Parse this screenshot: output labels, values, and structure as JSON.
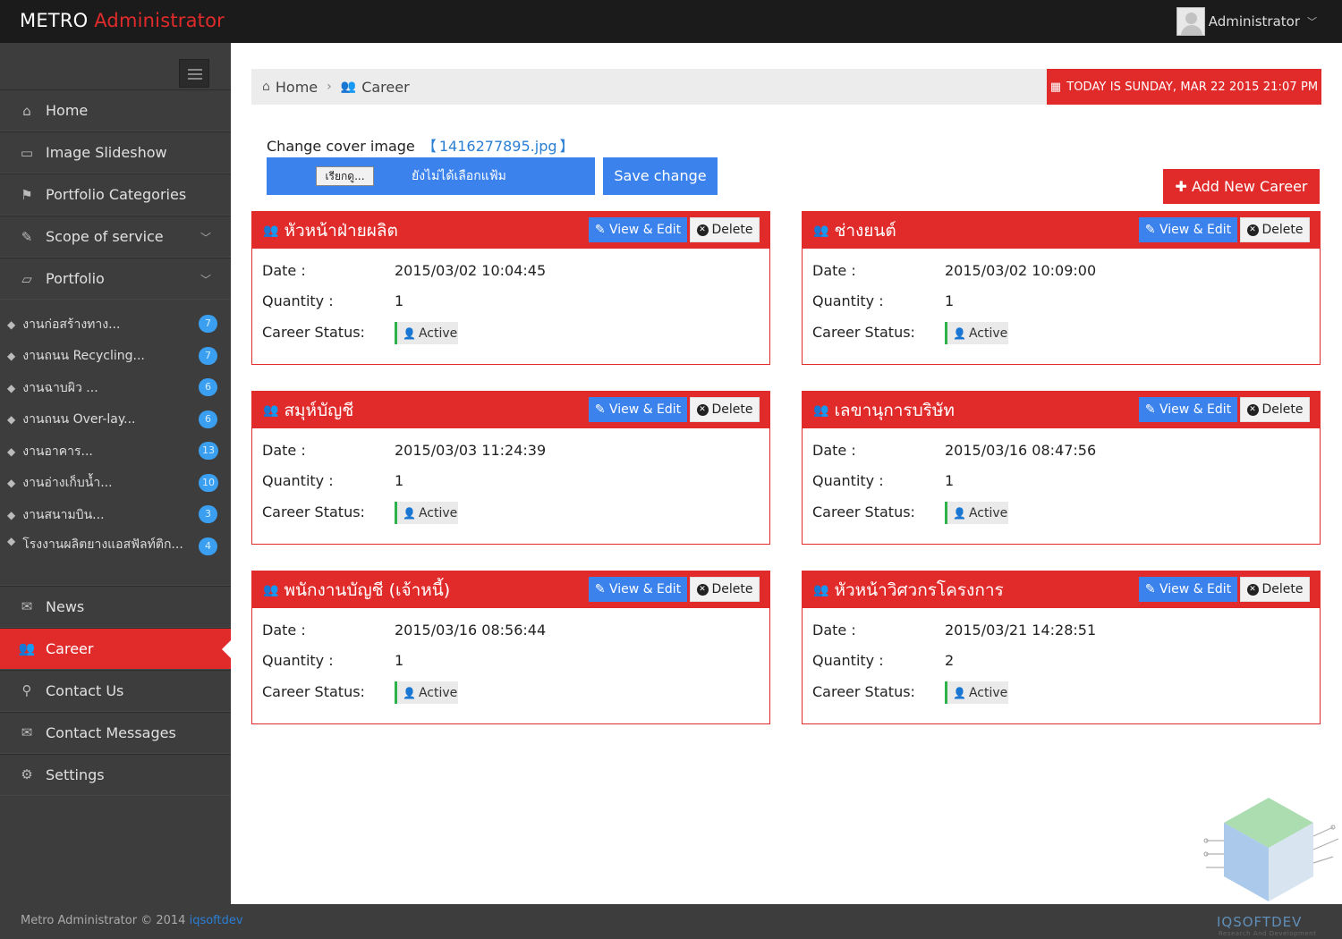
{
  "header": {
    "brand_part1": "METRO",
    "brand_part2": "Administrator",
    "user_name": "Administrator",
    "caret": "﹀"
  },
  "sidebar": {
    "menu": [
      {
        "label": "Home",
        "icon": "home-icon",
        "glyph": "⌂"
      },
      {
        "label": "Image Slideshow",
        "icon": "image-icon",
        "glyph": "▭"
      },
      {
        "label": "Portfolio Categories",
        "icon": "sitemap-icon",
        "glyph": "⚑"
      },
      {
        "label": "Scope of service",
        "icon": "wrench-icon",
        "glyph": "✎"
      },
      {
        "label": "Portfolio",
        "icon": "folder-open-icon",
        "glyph": "▱"
      }
    ],
    "submenu": [
      {
        "label": "งานก่อสร้างทาง...",
        "count": "7"
      },
      {
        "label": "งานถนน Recycling...",
        "count": "7"
      },
      {
        "label": "งานฉาบผิว ...",
        "count": "6"
      },
      {
        "label": "งานถนน Over-lay...",
        "count": "6"
      },
      {
        "label": "งานอาคาร...",
        "count": "13"
      },
      {
        "label": "งานอ่างเก็บน้ำ...",
        "count": "10"
      },
      {
        "label": "งานสนามบิน...",
        "count": "3"
      },
      {
        "label": "โรงงานผลิตยางแอสฟัลท์ติก...",
        "count": "4"
      }
    ],
    "menu2": [
      {
        "label": "News",
        "icon": "bullhorn-icon",
        "glyph": "✉"
      },
      {
        "label": "Career",
        "icon": "group-icon",
        "glyph": "👥"
      },
      {
        "label": "Contact Us",
        "icon": "map-marker-icon",
        "glyph": "⚲"
      },
      {
        "label": "Contact Messages",
        "icon": "envelope-icon",
        "glyph": "✉"
      },
      {
        "label": "Settings",
        "icon": "cogs-icon",
        "glyph": "⚙"
      }
    ]
  },
  "breadcrumb": {
    "home": "Home",
    "current": "Career",
    "today": "TODAY IS SUNDAY, MAR 22 2015 21:07 PM"
  },
  "cover": {
    "label": "Change cover image",
    "bracket_open": "【",
    "filename": "1416277895.jpg",
    "bracket_close": "】",
    "browse_label": "เรียกดู...",
    "no_file_label": "ยังไม่ได้เลือกแฟ้ม",
    "save_label": "Save change"
  },
  "add_button": "Add New Career",
  "labels": {
    "date": "Date :",
    "quantity": "Quantity :",
    "status": "Career Status:",
    "view_edit": "View & Edit",
    "delete": "Delete"
  },
  "careers": [
    {
      "title": "หัวหน้าฝ่ายผลิต",
      "date": "2015/03/02 10:04:45",
      "quantity": "1",
      "status": "Active"
    },
    {
      "title": "ช่างยนต์",
      "date": "2015/03/02 10:09:00",
      "quantity": "1",
      "status": "Active"
    },
    {
      "title": "สมุห์บัญชี",
      "date": "2015/03/03 11:24:39",
      "quantity": "1",
      "status": "Active"
    },
    {
      "title": "เลขานุการบริษัท",
      "date": "2015/03/16 08:47:56",
      "quantity": "1",
      "status": "Active"
    },
    {
      "title": "พนักงานบัญชี (เจ้าหนี้)",
      "date": "2015/03/16 08:56:44",
      "quantity": "1",
      "status": "Active"
    },
    {
      "title": "หัวหน้าวิศวกรโครงการ",
      "date": "2015/03/21 14:28:51",
      "quantity": "2",
      "status": "Active"
    }
  ],
  "footer": {
    "text": "Metro Administrator © 2014",
    "link": "iqsoftdev"
  },
  "watermark": {
    "name": "IQSOFTDEV",
    "tagline": "Research And Development"
  }
}
